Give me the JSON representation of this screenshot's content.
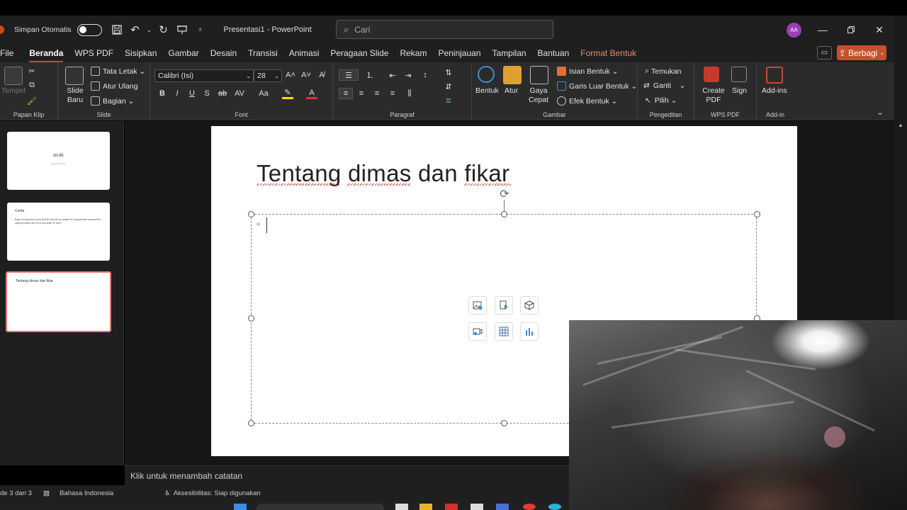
{
  "window": {
    "autosave_label": "Simpan Otomatis",
    "doc_title": "Presentasi1 - PowerPoint",
    "search_placeholder": "Cari",
    "avatar_initials": "AA"
  },
  "menu": {
    "items": [
      "File",
      "Beranda",
      "WPS PDF",
      "Sisipkan",
      "Gambar",
      "Desain",
      "Transisi",
      "Animasi",
      "Peragaan Slide",
      "Rekam",
      "Peninjauan",
      "Tampilan",
      "Bantuan",
      "Format Bentuk"
    ],
    "active": "Beranda",
    "share_label": "Berbagi"
  },
  "ribbon": {
    "clipboard": {
      "paste": "Tempel",
      "label": "Papan Klip"
    },
    "slide": {
      "new_slide": "Slide Baru",
      "layout": "Tata Letak",
      "reset": "Atur Ulang",
      "section": "Bagian",
      "label": "Slide"
    },
    "font": {
      "family": "Calibri (Isi)",
      "size": "28",
      "label": "Font"
    },
    "paragraph": {
      "label": "Paragraf"
    },
    "drawing": {
      "shapes": "Bentuk",
      "arrange": "Atur",
      "quick_styles": "Gaya Cepat",
      "fill": "Isian Bentuk",
      "outline": "Garis Luar Bentuk",
      "effects": "Efek Bentuk",
      "label": "Gambar"
    },
    "editing": {
      "find": "Temukan",
      "replace": "Ganti",
      "select": "Pilih",
      "label": "Pengeditan"
    },
    "wps": {
      "create_pdf": "Create PDF",
      "sign": "Sign",
      "label": "WPS PDF"
    },
    "addins": {
      "addins": "Add-ins",
      "label": "Add-in"
    }
  },
  "slides": [
    {
      "title": "acak",
      "subtitle": "Fanny ditto ana"
    },
    {
      "title": "Cerita",
      "body": "Bapa sedang lima puluh jenida dan beli ke dadak 50 kepepat ada sewa jemila saja jemudian nan 30 ia ada tidak 30 ada?"
    },
    {
      "title": "Tentang dimas dan fikar"
    }
  ],
  "current_slide": {
    "title": "Tentang dimas dan fikar"
  },
  "notes_placeholder": "Klik untuk menambah catatan",
  "status": {
    "slide_counter": "de 3 dari 3",
    "language": "Bahasa Indonesia",
    "accessibility": "Aksesibilitas: Siap digunakan"
  },
  "colors": {
    "accent": "#d24726",
    "share_button": "#c4502c",
    "avatar": "#9b3fb8",
    "selected_thumb_border": "#e8786a"
  }
}
